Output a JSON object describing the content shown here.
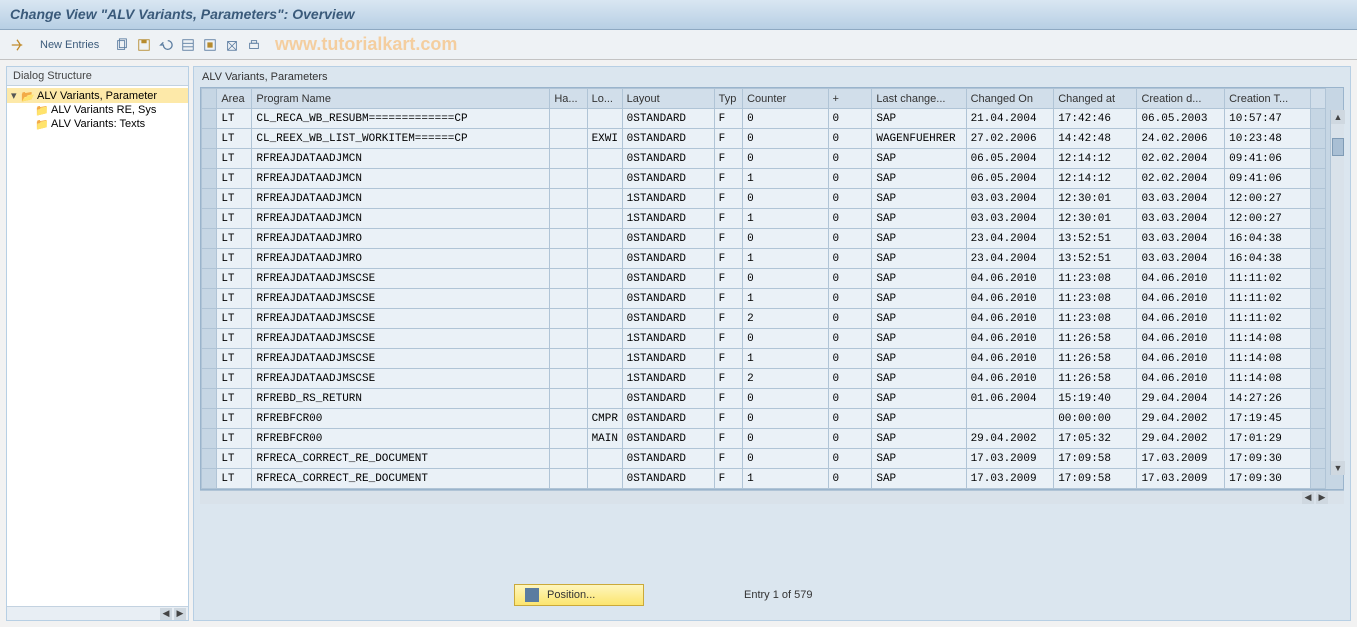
{
  "title": "Change View \"ALV Variants, Parameters\": Overview",
  "watermark": "www.tutorialkart.com",
  "toolbar": {
    "new_entries": "New Entries"
  },
  "sidebar": {
    "header": "Dialog Structure",
    "nodes": [
      {
        "label": "ALV Variants, Parameter",
        "expanded": true,
        "selected": true
      },
      {
        "label": "ALV Variants RE, Sys",
        "child": true
      },
      {
        "label": "ALV Variants: Texts",
        "child": true
      }
    ]
  },
  "content": {
    "title": "ALV Variants, Parameters",
    "columns": [
      "Area",
      "Program Name",
      "Ha...",
      "Lo...",
      "Layout",
      "Typ",
      "Counter",
      "+",
      "Last change...",
      "Changed On",
      "Changed at",
      "Creation d...",
      "Creation T..."
    ],
    "rows": [
      [
        "LT",
        "CL_RECA_WB_RESUBM=============CP",
        "",
        "",
        "0STANDARD",
        "F",
        "0",
        "0",
        "SAP",
        "21.04.2004",
        "17:42:46",
        "06.05.2003",
        "10:57:47"
      ],
      [
        "LT",
        "CL_REEX_WB_LIST_WORKITEM======CP",
        "",
        "EXWI",
        "0STANDARD",
        "F",
        "0",
        "0",
        "WAGENFUEHRER",
        "27.02.2006",
        "14:42:48",
        "24.02.2006",
        "10:23:48"
      ],
      [
        "LT",
        "RFREAJDATAADJMCN",
        "",
        "",
        "0STANDARD",
        "F",
        "0",
        "0",
        "SAP",
        "06.05.2004",
        "12:14:12",
        "02.02.2004",
        "09:41:06"
      ],
      [
        "LT",
        "RFREAJDATAADJMCN",
        "",
        "",
        "0STANDARD",
        "F",
        "1",
        "0",
        "SAP",
        "06.05.2004",
        "12:14:12",
        "02.02.2004",
        "09:41:06"
      ],
      [
        "LT",
        "RFREAJDATAADJMCN",
        "",
        "",
        "1STANDARD",
        "F",
        "0",
        "0",
        "SAP",
        "03.03.2004",
        "12:30:01",
        "03.03.2004",
        "12:00:27"
      ],
      [
        "LT",
        "RFREAJDATAADJMCN",
        "",
        "",
        "1STANDARD",
        "F",
        "1",
        "0",
        "SAP",
        "03.03.2004",
        "12:30:01",
        "03.03.2004",
        "12:00:27"
      ],
      [
        "LT",
        "RFREAJDATAADJMRO",
        "",
        "",
        "0STANDARD",
        "F",
        "0",
        "0",
        "SAP",
        "23.04.2004",
        "13:52:51",
        "03.03.2004",
        "16:04:38"
      ],
      [
        "LT",
        "RFREAJDATAADJMRO",
        "",
        "",
        "0STANDARD",
        "F",
        "1",
        "0",
        "SAP",
        "23.04.2004",
        "13:52:51",
        "03.03.2004",
        "16:04:38"
      ],
      [
        "LT",
        "RFREAJDATAADJMSCSE",
        "",
        "",
        "0STANDARD",
        "F",
        "0",
        "0",
        "SAP",
        "04.06.2010",
        "11:23:08",
        "04.06.2010",
        "11:11:02"
      ],
      [
        "LT",
        "RFREAJDATAADJMSCSE",
        "",
        "",
        "0STANDARD",
        "F",
        "1",
        "0",
        "SAP",
        "04.06.2010",
        "11:23:08",
        "04.06.2010",
        "11:11:02"
      ],
      [
        "LT",
        "RFREAJDATAADJMSCSE",
        "",
        "",
        "0STANDARD",
        "F",
        "2",
        "0",
        "SAP",
        "04.06.2010",
        "11:23:08",
        "04.06.2010",
        "11:11:02"
      ],
      [
        "LT",
        "RFREAJDATAADJMSCSE",
        "",
        "",
        "1STANDARD",
        "F",
        "0",
        "0",
        "SAP",
        "04.06.2010",
        "11:26:58",
        "04.06.2010",
        "11:14:08"
      ],
      [
        "LT",
        "RFREAJDATAADJMSCSE",
        "",
        "",
        "1STANDARD",
        "F",
        "1",
        "0",
        "SAP",
        "04.06.2010",
        "11:26:58",
        "04.06.2010",
        "11:14:08"
      ],
      [
        "LT",
        "RFREAJDATAADJMSCSE",
        "",
        "",
        "1STANDARD",
        "F",
        "2",
        "0",
        "SAP",
        "04.06.2010",
        "11:26:58",
        "04.06.2010",
        "11:14:08"
      ],
      [
        "LT",
        "RFREBD_RS_RETURN",
        "",
        "",
        "0STANDARD",
        "F",
        "0",
        "0",
        "SAP",
        "01.06.2004",
        "15:19:40",
        "29.04.2004",
        "14:27:26"
      ],
      [
        "LT",
        "RFREBFCR00",
        "",
        "CMPR",
        "0STANDARD",
        "F",
        "0",
        "0",
        "SAP",
        "",
        "00:00:00",
        "29.04.2002",
        "17:19:45"
      ],
      [
        "LT",
        "RFREBFCR00",
        "",
        "MAIN",
        "0STANDARD",
        "F",
        "0",
        "0",
        "SAP",
        "29.04.2002",
        "17:05:32",
        "29.04.2002",
        "17:01:29"
      ],
      [
        "LT",
        "RFRECA_CORRECT_RE_DOCUMENT",
        "",
        "",
        "0STANDARD",
        "F",
        "0",
        "0",
        "SAP",
        "17.03.2009",
        "17:09:58",
        "17.03.2009",
        "17:09:30"
      ],
      [
        "LT",
        "RFRECA_CORRECT_RE_DOCUMENT",
        "",
        "",
        "0STANDARD",
        "F",
        "1",
        "0",
        "SAP",
        "17.03.2009",
        "17:09:58",
        "17.03.2009",
        "17:09:30"
      ]
    ]
  },
  "footer": {
    "position_label": "Position...",
    "entry_text": "Entry 1 of 579"
  }
}
